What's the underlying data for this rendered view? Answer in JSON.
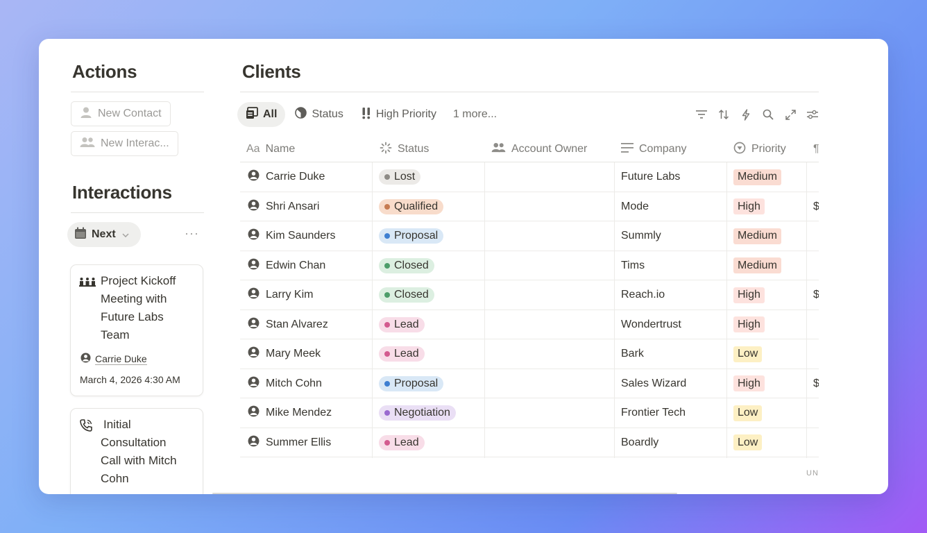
{
  "actions": {
    "title": "Actions",
    "buttons": [
      {
        "label": "New Contact",
        "icon": "person-icon"
      },
      {
        "label": "New Interac...",
        "icon": "people-icon"
      }
    ]
  },
  "interactions": {
    "title": "Interactions",
    "view_label": "Next",
    "more_label": "···",
    "cards": [
      {
        "title_lines": [
          "Project Kickoff",
          "Meeting with",
          "Future Labs",
          "Team"
        ],
        "icon": "meeting-icon",
        "person": "Carrie Duke",
        "date": "March 4, 2026 4:30 AM"
      },
      {
        "title_lines": [
          "Initial",
          "Consultation",
          "Call with Mitch",
          "Cohn"
        ],
        "icon": "phone-call-icon"
      }
    ]
  },
  "clients": {
    "title": "Clients",
    "tabs": [
      {
        "label": "All",
        "icon": "table-icon",
        "active": true
      },
      {
        "label": "Status",
        "icon": "pie-icon",
        "active": false
      },
      {
        "label": "High Priority",
        "icon": "exclamation-icon",
        "active": false
      }
    ],
    "more_tabs": "1 more...",
    "tools": [
      "filter-icon",
      "sort-icon",
      "lightning-icon",
      "search-icon",
      "expand-icon",
      "settings-sliders-icon"
    ],
    "columns": [
      "Name",
      "Status",
      "Account Owner",
      "Company",
      "Priority"
    ],
    "rows": [
      {
        "name": "Carrie Duke",
        "status": "Lost",
        "company": "Future Labs",
        "priority": "Medium",
        "extra": ""
      },
      {
        "name": "Shri Ansari",
        "status": "Qualified",
        "company": "Mode",
        "priority": "High",
        "extra": "$"
      },
      {
        "name": "Kim Saunders",
        "status": "Proposal",
        "company": "Summly",
        "priority": "Medium",
        "extra": ""
      },
      {
        "name": "Edwin Chan",
        "status": "Closed",
        "company": "Tims",
        "priority": "Medium",
        "extra": ""
      },
      {
        "name": "Larry Kim",
        "status": "Closed",
        "company": "Reach.io",
        "priority": "High",
        "extra": "$"
      },
      {
        "name": "Stan Alvarez",
        "status": "Lead",
        "company": "Wondertrust",
        "priority": "High",
        "extra": ""
      },
      {
        "name": "Mary Meek",
        "status": "Lead",
        "company": "Bark",
        "priority": "Low",
        "extra": ""
      },
      {
        "name": "Mitch Cohn",
        "status": "Proposal",
        "company": "Sales Wizard",
        "priority": "High",
        "extra": "$"
      },
      {
        "name": "Mike Mendez",
        "status": "Negotiation",
        "company": "Frontier Tech",
        "priority": "Low",
        "extra": ""
      },
      {
        "name": "Summer Ellis",
        "status": "Lead",
        "company": "Boardly",
        "priority": "Low",
        "extra": ""
      }
    ],
    "footer_hint": "UN",
    "status_colors": {
      "Lost": {
        "bg": "#eceae7",
        "dot": "#8e8b86"
      },
      "Qualified": {
        "bg": "#f8dccb",
        "dot": "#c67b52"
      },
      "Proposal": {
        "bg": "#d9e8f6",
        "dot": "#3e7fd1"
      },
      "Closed": {
        "bg": "#dcefe1",
        "dot": "#4d9d6a"
      },
      "Lead": {
        "bg": "#f8dde8",
        "dot": "#d35b8f"
      },
      "Negotiation": {
        "bg": "#eadff5",
        "dot": "#9a6ad0"
      }
    },
    "priority_colors": {
      "Medium": "#fadcd2",
      "High": "#fde2de",
      "Low": "#fdf0c4"
    }
  }
}
